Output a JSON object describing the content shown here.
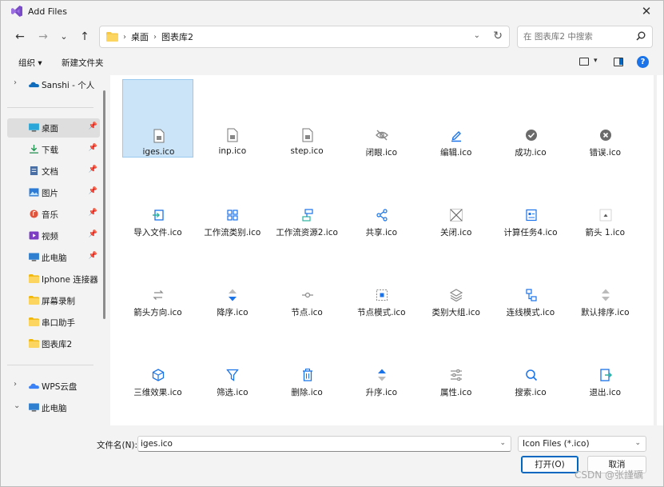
{
  "window": {
    "title": "Add Files",
    "close_glyph": "✕"
  },
  "nav": {
    "back": "←",
    "forward": "→",
    "recent": "⌄",
    "up": "↑",
    "breadcrumb": [
      "桌面",
      "图表库2"
    ],
    "search_placeholder": "在 图表库2 中搜索"
  },
  "commandbar": {
    "organize": "组织 ▾",
    "new_folder": "新建文件夹",
    "help": "?"
  },
  "sidebar": {
    "items": [
      {
        "label": "Sanshi - 个人",
        "icon": "onedrive-icon",
        "chev": "›",
        "pinned": false
      },
      {
        "label": "桌面",
        "icon": "desktop-icon",
        "chev": "",
        "pinned": true,
        "selected": true
      },
      {
        "label": "下载",
        "icon": "download-icon",
        "chev": "",
        "pinned": true
      },
      {
        "label": "文档",
        "icon": "document-icon",
        "chev": "",
        "pinned": true
      },
      {
        "label": "图片",
        "icon": "pictures-icon",
        "chev": "",
        "pinned": true
      },
      {
        "label": "音乐",
        "icon": "music-icon",
        "chev": "",
        "pinned": true
      },
      {
        "label": "视频",
        "icon": "video-icon",
        "chev": "",
        "pinned": true
      },
      {
        "label": "此电脑",
        "icon": "computer-icon",
        "chev": "",
        "pinned": true
      },
      {
        "label": "Iphone 连接器",
        "icon": "folder-icon",
        "chev": "",
        "pinned": false
      },
      {
        "label": "屏幕录制",
        "icon": "folder-icon",
        "chev": "",
        "pinned": false
      },
      {
        "label": "串口助手",
        "icon": "folder-icon",
        "chev": "",
        "pinned": false
      },
      {
        "label": "图表库2",
        "icon": "folder-icon",
        "chev": "",
        "pinned": false
      },
      {
        "label": "WPS云盘",
        "icon": "cloud-icon",
        "chev": "›",
        "pinned": false
      },
      {
        "label": "此电脑",
        "icon": "computer-icon",
        "chev": "⌄",
        "pinned": false
      }
    ]
  },
  "files": [
    {
      "name": "iges.ico",
      "icon": "file-icon",
      "selected": true
    },
    {
      "name": "inp.ico",
      "icon": "file-icon"
    },
    {
      "name": "step.ico",
      "icon": "file-icon"
    },
    {
      "name": "闭眼.ico",
      "icon": "eye-closed-icon"
    },
    {
      "name": "编辑.ico",
      "icon": "edit-icon"
    },
    {
      "name": "成功.ico",
      "icon": "success-icon"
    },
    {
      "name": "错误.ico",
      "icon": "error-icon"
    },
    {
      "name": "导入文件.ico",
      "icon": "import-icon"
    },
    {
      "name": "工作流类别.ico",
      "icon": "grid-icon"
    },
    {
      "name": "工作流资源2.ico",
      "icon": "workflow-icon"
    },
    {
      "name": "共享.ico",
      "icon": "share-icon"
    },
    {
      "name": "关闭.ico",
      "icon": "close-x-icon"
    },
    {
      "name": "计算任务4.ico",
      "icon": "task-icon"
    },
    {
      "name": "箭头 1.ico",
      "icon": "arrow-up-icon"
    },
    {
      "name": "箭头方向.ico",
      "icon": "arrows-lr-icon"
    },
    {
      "name": "降序.ico",
      "icon": "sort-desc-icon"
    },
    {
      "name": "节点.ico",
      "icon": "node-icon"
    },
    {
      "name": "节点模式.ico",
      "icon": "node-mode-icon"
    },
    {
      "name": "类别大组.ico",
      "icon": "layers-icon"
    },
    {
      "name": "连线模式.ico",
      "icon": "link-mode-icon"
    },
    {
      "name": "默认排序.ico",
      "icon": "sort-default-icon"
    },
    {
      "name": "三维效果.ico",
      "icon": "cube-icon"
    },
    {
      "name": "筛选.ico",
      "icon": "filter-icon"
    },
    {
      "name": "删除.ico",
      "icon": "delete-icon"
    },
    {
      "name": "升序.ico",
      "icon": "sort-asc-icon"
    },
    {
      "name": "属性.ico",
      "icon": "properties-icon"
    },
    {
      "name": "搜索.ico",
      "icon": "search-icon"
    },
    {
      "name": "退出.ico",
      "icon": "exit-icon"
    }
  ],
  "footer": {
    "filename_label": "文件名(N):",
    "filename_value": "iges.ico",
    "filter_value": "Icon Files (*.ico)",
    "open_label": "打开(O)",
    "cancel_label": "取消"
  },
  "watermark": "CSDN @张謹礪",
  "colors": {
    "accent": "#0067c0",
    "icon_blue": "#1a73e8",
    "selection": "#cce4f7"
  }
}
